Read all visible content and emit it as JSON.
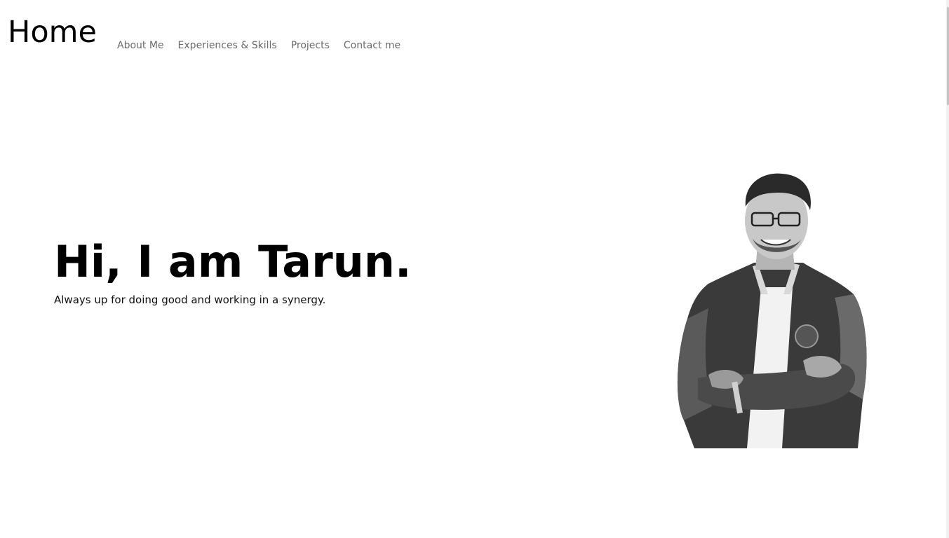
{
  "header": {
    "brand": "Home"
  },
  "nav": {
    "items": [
      {
        "label": "About Me"
      },
      {
        "label": "Experiences & Skills"
      },
      {
        "label": "Projects"
      },
      {
        "label": "Contact me"
      }
    ]
  },
  "hero": {
    "title": "Hi, I am Tarun.",
    "subtitle": "Always up for doing good and working in a synergy."
  },
  "colors": {
    "background": "#ffffff",
    "text": "#000000",
    "nav_text": "#6b6b6b"
  },
  "icons": {
    "portrait": "person-photo"
  }
}
